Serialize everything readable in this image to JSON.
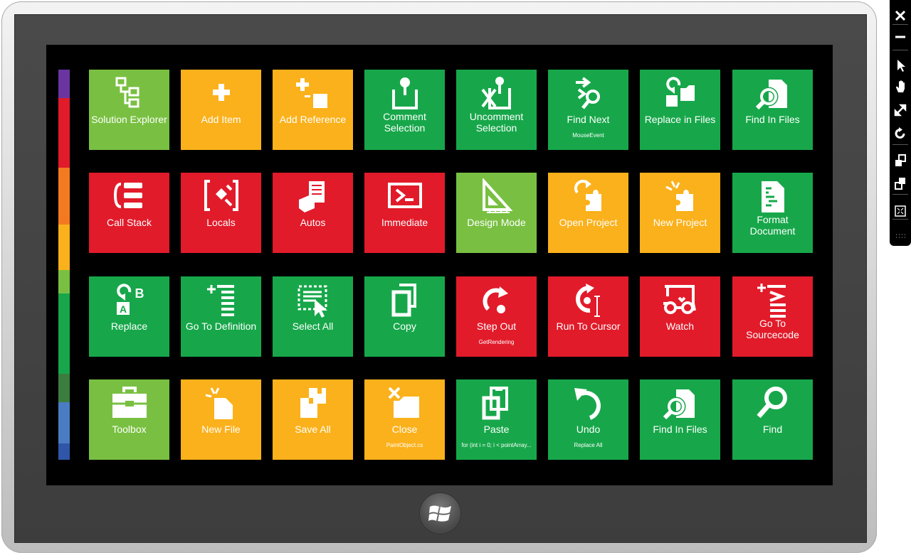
{
  "colors": {
    "green": "#17a74a",
    "lime": "#79c042",
    "orange": "#fbb11b",
    "red": "#e11b2a"
  },
  "strip": [
    "#6a35a0",
    "#e11b2a",
    "#f47a20",
    "#fbb11b",
    "#79c042",
    "#17a74a",
    "#3b7d3e",
    "#4a7cc4",
    "#2f56a8"
  ],
  "tiles": [
    {
      "label": "Solution Explorer",
      "color": "lime",
      "icon": "hierarchy-icon"
    },
    {
      "label": "Add Item",
      "color": "orange",
      "icon": "plus-icon"
    },
    {
      "label": "Add Reference",
      "color": "orange",
      "icon": "add-reference-icon"
    },
    {
      "label": "Comment Selection",
      "color": "green",
      "icon": "comment-icon"
    },
    {
      "label": "Uncomment Selection",
      "color": "green",
      "icon": "uncomment-icon"
    },
    {
      "label": "Find Next",
      "sub": "MouseEvent",
      "color": "green",
      "icon": "find-next-icon"
    },
    {
      "label": "Replace in Files",
      "color": "green",
      "icon": "replace-in-files-icon"
    },
    {
      "label": "Find In Files",
      "color": "green",
      "icon": "find-in-files-icon"
    },
    {
      "label": "Call Stack",
      "color": "red",
      "icon": "call-stack-icon"
    },
    {
      "label": "Locals",
      "color": "red",
      "icon": "locals-icon"
    },
    {
      "label": "Autos",
      "color": "red",
      "icon": "autos-icon"
    },
    {
      "label": "Immediate",
      "color": "red",
      "icon": "immediate-icon"
    },
    {
      "label": "Design Mode",
      "color": "lime",
      "icon": "ruler-triangle-icon"
    },
    {
      "label": "Open Project",
      "color": "orange",
      "icon": "open-project-icon"
    },
    {
      "label": "New Project",
      "color": "orange",
      "icon": "new-project-icon"
    },
    {
      "label": "Format Document",
      "color": "green",
      "icon": "format-document-icon"
    },
    {
      "label": "Replace",
      "color": "green",
      "icon": "replace-icon"
    },
    {
      "label": "Go To Definition",
      "color": "green",
      "icon": "go-to-definition-icon"
    },
    {
      "label": "Select All",
      "color": "green",
      "icon": "select-all-icon"
    },
    {
      "label": "Copy",
      "color": "green",
      "icon": "copy-icon"
    },
    {
      "label": "Step Out",
      "sub": "GetRendering",
      "color": "red",
      "icon": "step-out-icon"
    },
    {
      "label": "Run To Cursor",
      "color": "red",
      "icon": "run-to-cursor-icon"
    },
    {
      "label": "Watch",
      "color": "red",
      "icon": "watch-icon"
    },
    {
      "label": "Go To Sourcecode",
      "color": "red",
      "icon": "go-to-sourcecode-icon"
    },
    {
      "label": "Toolbox",
      "color": "lime",
      "icon": "toolbox-icon"
    },
    {
      "label": "New File",
      "color": "orange",
      "icon": "new-file-icon"
    },
    {
      "label": "Save All",
      "color": "orange",
      "icon": "save-all-icon"
    },
    {
      "label": "Close",
      "sub": "PaintObject.cs",
      "color": "orange",
      "icon": "close-file-icon"
    },
    {
      "label": "Paste",
      "sub": "for (int i = 0; i < pointArray...",
      "color": "green",
      "icon": "paste-icon"
    },
    {
      "label": "Undo",
      "sub": "Replace All",
      "color": "green",
      "icon": "undo-icon"
    },
    {
      "label": "Find In Files",
      "color": "green",
      "icon": "find-in-files-icon"
    },
    {
      "label": "Find",
      "color": "green",
      "icon": "search-icon"
    }
  ],
  "toolbar": [
    "close-icon",
    "minimize-icon",
    "pointer-icon",
    "hand-icon",
    "resize-icon",
    "rotate-icon",
    "dock-top-icon",
    "dock-bottom-icon",
    "fullscreen-icon",
    "grip-icon"
  ],
  "start_button": "windows-logo-icon"
}
